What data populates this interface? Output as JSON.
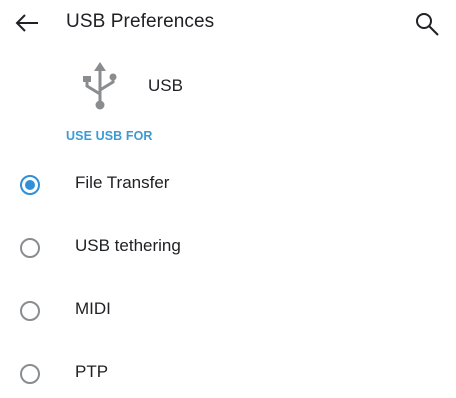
{
  "appbar": {
    "title": "USB Preferences",
    "back_icon": "arrow-left-icon",
    "search_icon": "search-icon"
  },
  "device": {
    "icon": "usb-icon",
    "label": "USB"
  },
  "section": {
    "header": "USE USB FOR"
  },
  "options": [
    {
      "label": "File Transfer",
      "selected": true
    },
    {
      "label": "USB tethering",
      "selected": false
    },
    {
      "label": "MIDI",
      "selected": false
    },
    {
      "label": "PTP",
      "selected": false
    }
  ],
  "colors": {
    "accent": "#2f8fd8",
    "section_header": "#3a9bd5",
    "radio_unchecked": "#8a8d90",
    "text": "#202124"
  }
}
